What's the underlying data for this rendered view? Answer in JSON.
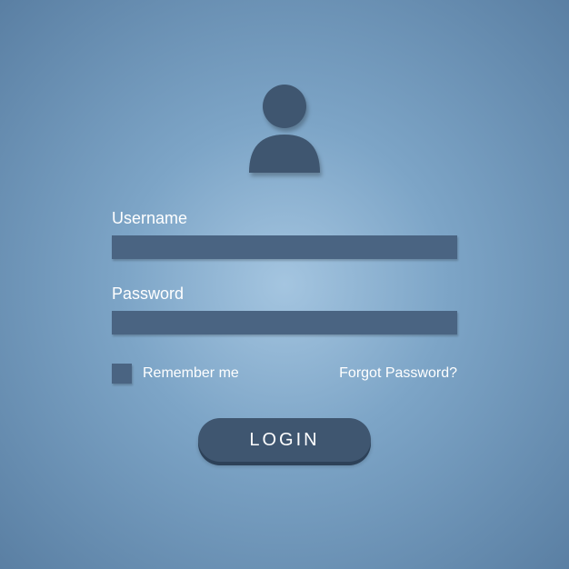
{
  "form": {
    "username_label": "Username",
    "password_label": "Password",
    "remember_label": "Remember me",
    "forgot_label": "Forgot Password?",
    "login_label": "LOGIN"
  },
  "colors": {
    "icon": "#3f5670",
    "input_bg": "#4a6482",
    "button_bg": "#3f5670"
  }
}
